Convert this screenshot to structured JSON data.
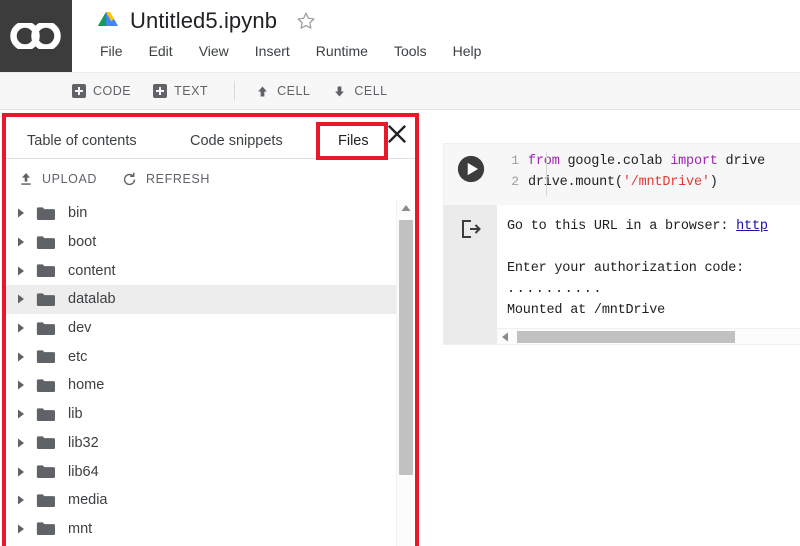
{
  "app": {
    "logo_text": "CO",
    "doc_title": "Untitled5.ipynb",
    "accent_red": "#e8172a",
    "selected_row_bg": "#ededed"
  },
  "menubar": {
    "items": [
      {
        "label": "File"
      },
      {
        "label": "Edit"
      },
      {
        "label": "View"
      },
      {
        "label": "Insert"
      },
      {
        "label": "Runtime"
      },
      {
        "label": "Tools"
      },
      {
        "label": "Help"
      }
    ]
  },
  "cell_toolbar": {
    "add_code_label": "CODE",
    "add_text_label": "TEXT",
    "move_up_label": "CELL",
    "move_down_label": "CELL"
  },
  "panel": {
    "tabs": [
      {
        "label": "Table of contents",
        "active": false
      },
      {
        "label": "Code snippets",
        "active": false
      },
      {
        "label": "Files",
        "active": true
      }
    ],
    "close_label": "✕",
    "actions": [
      {
        "label": "UPLOAD",
        "icon": "upload-icon"
      },
      {
        "label": "REFRESH",
        "icon": "refresh-icon"
      }
    ],
    "tree": [
      {
        "name": "bin",
        "selected": false
      },
      {
        "name": "boot",
        "selected": false
      },
      {
        "name": "content",
        "selected": false
      },
      {
        "name": "datalab",
        "selected": true
      },
      {
        "name": "dev",
        "selected": false
      },
      {
        "name": "etc",
        "selected": false
      },
      {
        "name": "home",
        "selected": false
      },
      {
        "name": "lib",
        "selected": false
      },
      {
        "name": "lib32",
        "selected": false
      },
      {
        "name": "lib64",
        "selected": false
      },
      {
        "name": "media",
        "selected": false
      },
      {
        "name": "mnt",
        "selected": false
      }
    ]
  },
  "notebook": {
    "cell": {
      "lines": [
        {
          "number": "1",
          "tokens": [
            {
              "t": "from ",
              "c": "kw"
            },
            {
              "t": "google.colab ",
              "c": "plain"
            },
            {
              "t": "import ",
              "c": "kw"
            },
            {
              "t": "drive",
              "c": "plain"
            }
          ]
        },
        {
          "number": "2",
          "tokens": [
            {
              "t": "drive.mount(",
              "c": "plain"
            },
            {
              "t": "'/mntDrive'",
              "c": "str"
            },
            {
              "t": ")",
              "c": "plain"
            }
          ]
        }
      ],
      "output": {
        "line1_prefix": "Go to this URL in a browser: ",
        "line1_link": "http",
        "line2": "Enter your authorization code:",
        "line3": "..........",
        "line4": "Mounted at /mntDrive"
      }
    }
  }
}
